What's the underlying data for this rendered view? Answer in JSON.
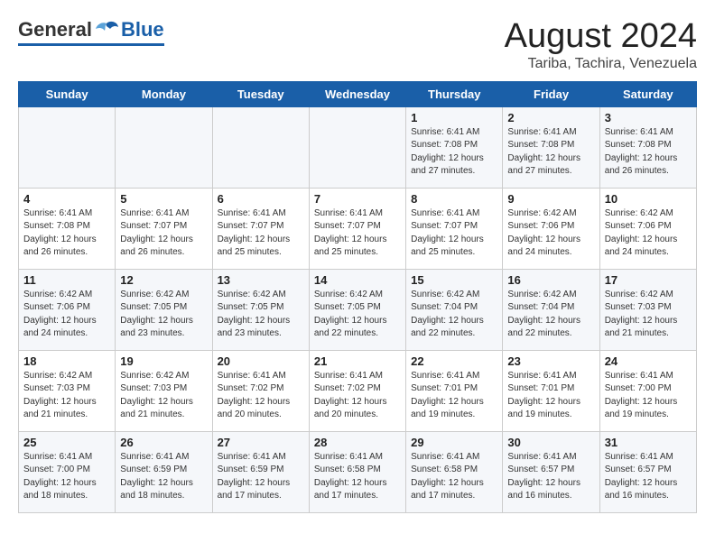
{
  "header": {
    "logo": {
      "general": "General",
      "blue": "Blue"
    },
    "title": "August 2024",
    "location": "Tariba, Tachira, Venezuela"
  },
  "weekdays": [
    "Sunday",
    "Monday",
    "Tuesday",
    "Wednesday",
    "Thursday",
    "Friday",
    "Saturday"
  ],
  "weeks": [
    [
      {
        "day": "",
        "info": ""
      },
      {
        "day": "",
        "info": ""
      },
      {
        "day": "",
        "info": ""
      },
      {
        "day": "",
        "info": ""
      },
      {
        "day": "1",
        "info": "Sunrise: 6:41 AM\nSunset: 7:08 PM\nDaylight: 12 hours\nand 27 minutes."
      },
      {
        "day": "2",
        "info": "Sunrise: 6:41 AM\nSunset: 7:08 PM\nDaylight: 12 hours\nand 27 minutes."
      },
      {
        "day": "3",
        "info": "Sunrise: 6:41 AM\nSunset: 7:08 PM\nDaylight: 12 hours\nand 26 minutes."
      }
    ],
    [
      {
        "day": "4",
        "info": "Sunrise: 6:41 AM\nSunset: 7:08 PM\nDaylight: 12 hours\nand 26 minutes."
      },
      {
        "day": "5",
        "info": "Sunrise: 6:41 AM\nSunset: 7:07 PM\nDaylight: 12 hours\nand 26 minutes."
      },
      {
        "day": "6",
        "info": "Sunrise: 6:41 AM\nSunset: 7:07 PM\nDaylight: 12 hours\nand 25 minutes."
      },
      {
        "day": "7",
        "info": "Sunrise: 6:41 AM\nSunset: 7:07 PM\nDaylight: 12 hours\nand 25 minutes."
      },
      {
        "day": "8",
        "info": "Sunrise: 6:41 AM\nSunset: 7:07 PM\nDaylight: 12 hours\nand 25 minutes."
      },
      {
        "day": "9",
        "info": "Sunrise: 6:42 AM\nSunset: 7:06 PM\nDaylight: 12 hours\nand 24 minutes."
      },
      {
        "day": "10",
        "info": "Sunrise: 6:42 AM\nSunset: 7:06 PM\nDaylight: 12 hours\nand 24 minutes."
      }
    ],
    [
      {
        "day": "11",
        "info": "Sunrise: 6:42 AM\nSunset: 7:06 PM\nDaylight: 12 hours\nand 24 minutes."
      },
      {
        "day": "12",
        "info": "Sunrise: 6:42 AM\nSunset: 7:05 PM\nDaylight: 12 hours\nand 23 minutes."
      },
      {
        "day": "13",
        "info": "Sunrise: 6:42 AM\nSunset: 7:05 PM\nDaylight: 12 hours\nand 23 minutes."
      },
      {
        "day": "14",
        "info": "Sunrise: 6:42 AM\nSunset: 7:05 PM\nDaylight: 12 hours\nand 22 minutes."
      },
      {
        "day": "15",
        "info": "Sunrise: 6:42 AM\nSunset: 7:04 PM\nDaylight: 12 hours\nand 22 minutes."
      },
      {
        "day": "16",
        "info": "Sunrise: 6:42 AM\nSunset: 7:04 PM\nDaylight: 12 hours\nand 22 minutes."
      },
      {
        "day": "17",
        "info": "Sunrise: 6:42 AM\nSunset: 7:03 PM\nDaylight: 12 hours\nand 21 minutes."
      }
    ],
    [
      {
        "day": "18",
        "info": "Sunrise: 6:42 AM\nSunset: 7:03 PM\nDaylight: 12 hours\nand 21 minutes."
      },
      {
        "day": "19",
        "info": "Sunrise: 6:42 AM\nSunset: 7:03 PM\nDaylight: 12 hours\nand 21 minutes."
      },
      {
        "day": "20",
        "info": "Sunrise: 6:41 AM\nSunset: 7:02 PM\nDaylight: 12 hours\nand 20 minutes."
      },
      {
        "day": "21",
        "info": "Sunrise: 6:41 AM\nSunset: 7:02 PM\nDaylight: 12 hours\nand 20 minutes."
      },
      {
        "day": "22",
        "info": "Sunrise: 6:41 AM\nSunset: 7:01 PM\nDaylight: 12 hours\nand 19 minutes."
      },
      {
        "day": "23",
        "info": "Sunrise: 6:41 AM\nSunset: 7:01 PM\nDaylight: 12 hours\nand 19 minutes."
      },
      {
        "day": "24",
        "info": "Sunrise: 6:41 AM\nSunset: 7:00 PM\nDaylight: 12 hours\nand 19 minutes."
      }
    ],
    [
      {
        "day": "25",
        "info": "Sunrise: 6:41 AM\nSunset: 7:00 PM\nDaylight: 12 hours\nand 18 minutes."
      },
      {
        "day": "26",
        "info": "Sunrise: 6:41 AM\nSunset: 6:59 PM\nDaylight: 12 hours\nand 18 minutes."
      },
      {
        "day": "27",
        "info": "Sunrise: 6:41 AM\nSunset: 6:59 PM\nDaylight: 12 hours\nand 17 minutes."
      },
      {
        "day": "28",
        "info": "Sunrise: 6:41 AM\nSunset: 6:58 PM\nDaylight: 12 hours\nand 17 minutes."
      },
      {
        "day": "29",
        "info": "Sunrise: 6:41 AM\nSunset: 6:58 PM\nDaylight: 12 hours\nand 17 minutes."
      },
      {
        "day": "30",
        "info": "Sunrise: 6:41 AM\nSunset: 6:57 PM\nDaylight: 12 hours\nand 16 minutes."
      },
      {
        "day": "31",
        "info": "Sunrise: 6:41 AM\nSunset: 6:57 PM\nDaylight: 12 hours\nand 16 minutes."
      }
    ]
  ]
}
